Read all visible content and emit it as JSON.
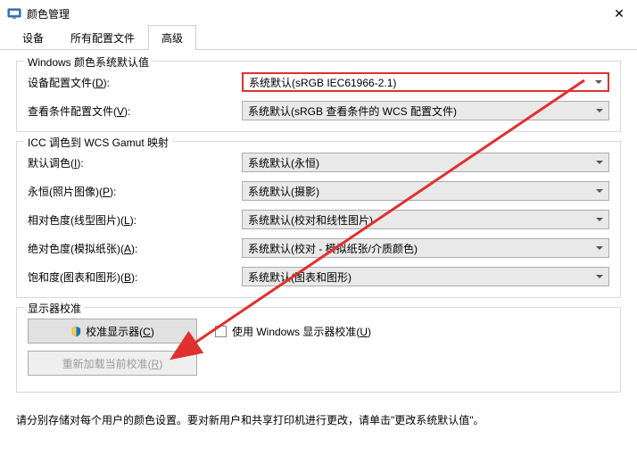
{
  "window": {
    "title": "颜色管理"
  },
  "tabs": {
    "device": "设备",
    "profiles": "所有配置文件",
    "advanced": "高级"
  },
  "group1": {
    "title": "Windows 颜色系统默认值",
    "deviceProfile": {
      "label": "设备配置文件(",
      "hotkey": "D",
      "suffix": "):",
      "value": "系统默认(sRGB IEC61966-2.1)"
    },
    "viewingProfile": {
      "label": "查看条件配置文件(",
      "hotkey": "V",
      "suffix": "):",
      "value": "系统默认(sRGB 查看条件的 WCS 配置文件)"
    }
  },
  "group2": {
    "title": "ICC 调色到 WCS Gamut 映射",
    "defaultIntent": {
      "label": "默认调色(",
      "hotkey": "I",
      "suffix": "):",
      "value": "系统默认(永恒)"
    },
    "perceptual": {
      "label": "永恒(照片图像)(",
      "hotkey": "P",
      "suffix": "):",
      "value": "系统默认(摄影)"
    },
    "relative": {
      "label": "相对色度(线型图片)(",
      "hotkey": "L",
      "suffix": "):",
      "value": "系统默认(校对和线性图片)"
    },
    "absolute": {
      "label": "绝对色度(模拟纸张)(",
      "hotkey": "A",
      "suffix": "):",
      "value": "系统默认(校对 - 模拟纸张/介质颜色)"
    },
    "saturation": {
      "label": "饱和度(图表和图形)(",
      "hotkey": "B",
      "suffix": "):",
      "value": "系统默认(图表和图形)"
    }
  },
  "group3": {
    "title": "显示器校准",
    "calibrateBtn": {
      "label": "校准显示器(",
      "hotkey": "C",
      "suffix": ")"
    },
    "reloadBtn": {
      "label": "重新加载当前校准(",
      "hotkey": "R",
      "suffix": ")"
    },
    "useWinCal": {
      "label": "使用 Windows 显示器校准(",
      "hotkey": "U",
      "suffix": ")"
    }
  },
  "footer": {
    "text": "请分别存储对每个用户的颜色设置。要对新用户和共享打印机进行更改，请单击\"更改系统默认值\"。"
  }
}
